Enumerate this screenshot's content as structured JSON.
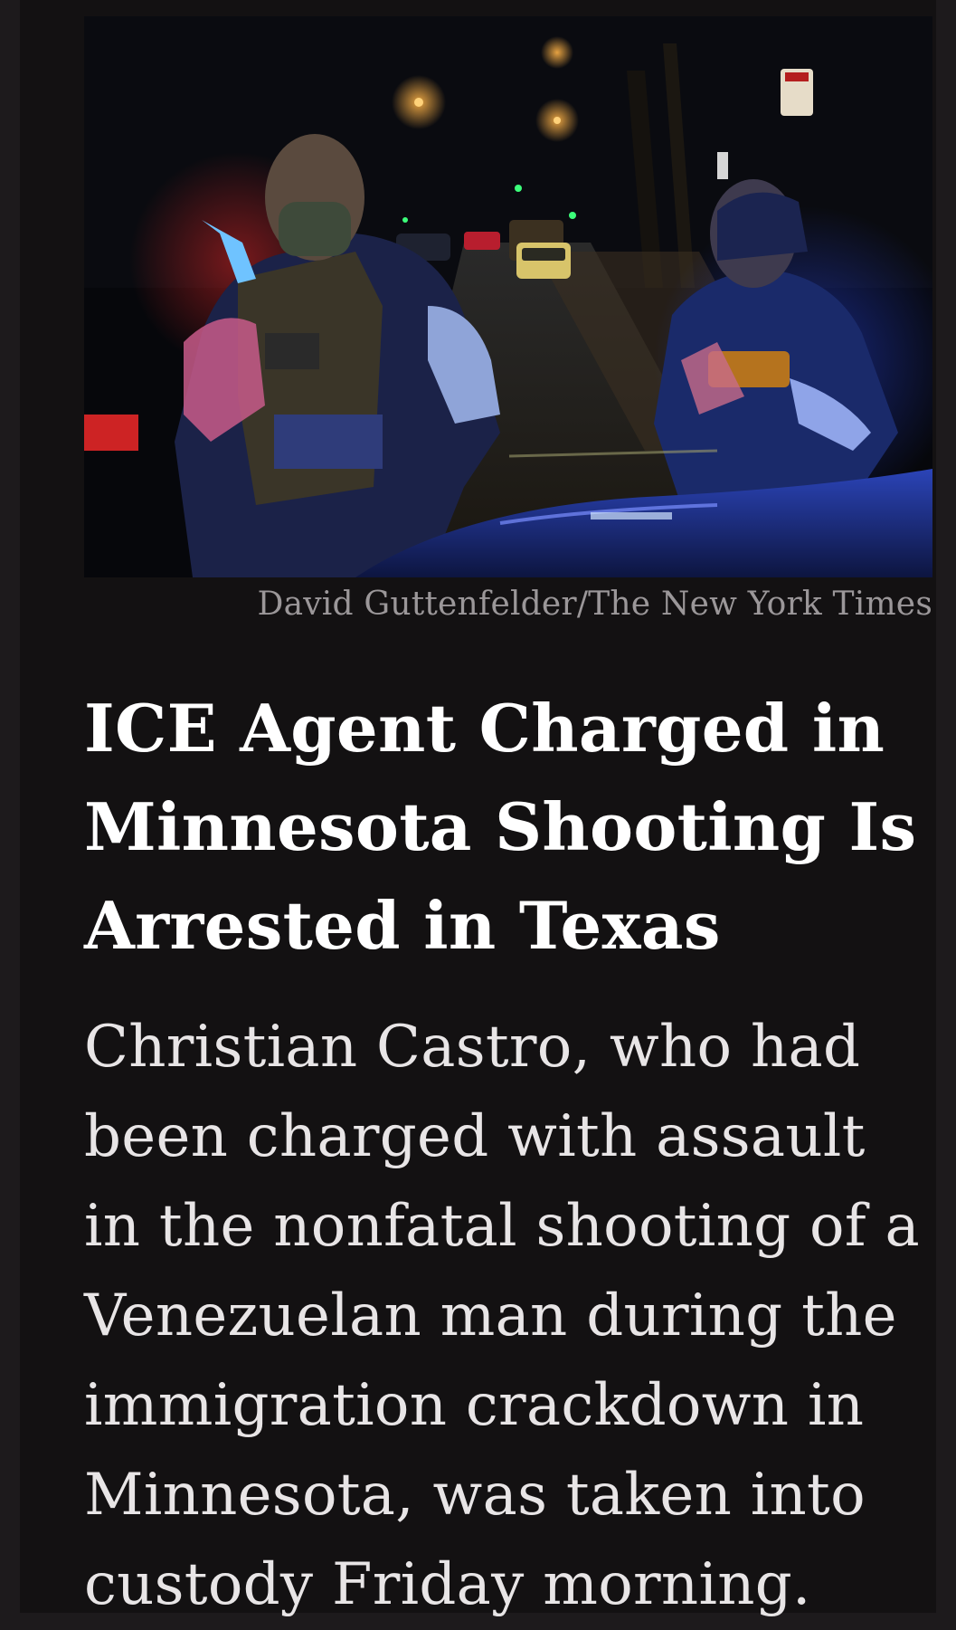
{
  "article": {
    "photo_credit": "David Guttenfelder/The New York Times",
    "headline": "ICE Agent Charged in Minnesota Shooting Is Arrested in Texas",
    "summary": "Christian Castro, who had been charged with assault in the nonfatal shooting of a Venezuelan man during the immigration crackdown in Minnesota, was taken into custody Friday morning."
  },
  "colors": {
    "background": "#131112",
    "outer_background": "#1d1a1c",
    "headline": "#ffffff",
    "summary": "#e8e5e6",
    "credit": "#9b9799"
  }
}
